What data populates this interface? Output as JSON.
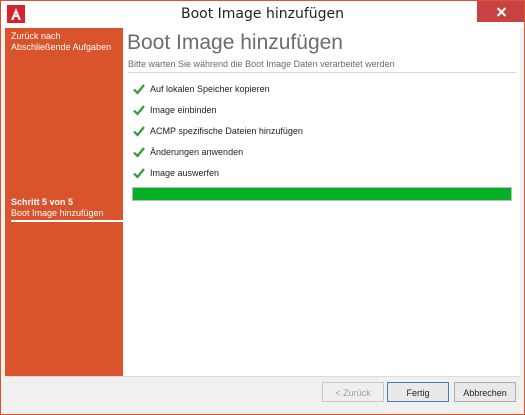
{
  "window": {
    "title": "Boot Image hinzufügen",
    "accent_color": "#d9532c"
  },
  "sidebar": {
    "back_link": "Zurück nach Abschließende Aufgaben",
    "step_count": "Schritt 5 von 5",
    "step_name": "Boot Image hinzufügen"
  },
  "main": {
    "title": "Boot Image hinzufügen",
    "subtitle": "Bitte warten Sie während die Boot Image Daten verarbeitet werden",
    "tasks": [
      {
        "label": "Auf lokalen Speicher kopieren",
        "icon": "checkmark-icon",
        "status": "done"
      },
      {
        "label": "Image einbinden",
        "icon": "checkmark-icon",
        "status": "done"
      },
      {
        "label": "ACMP spezifische Dateien hinzufügen",
        "icon": "checkmark-icon",
        "status": "done"
      },
      {
        "label": "Änderungen anwenden",
        "icon": "checkmark-icon",
        "status": "done"
      },
      {
        "label": "Image auswerfen",
        "icon": "checkmark-icon",
        "status": "done"
      }
    ],
    "progress": {
      "value": 1.0,
      "color": "#06b025"
    }
  },
  "buttons": {
    "back": "< Zurück",
    "finish": "Fertig",
    "cancel": "Abbrechen"
  }
}
